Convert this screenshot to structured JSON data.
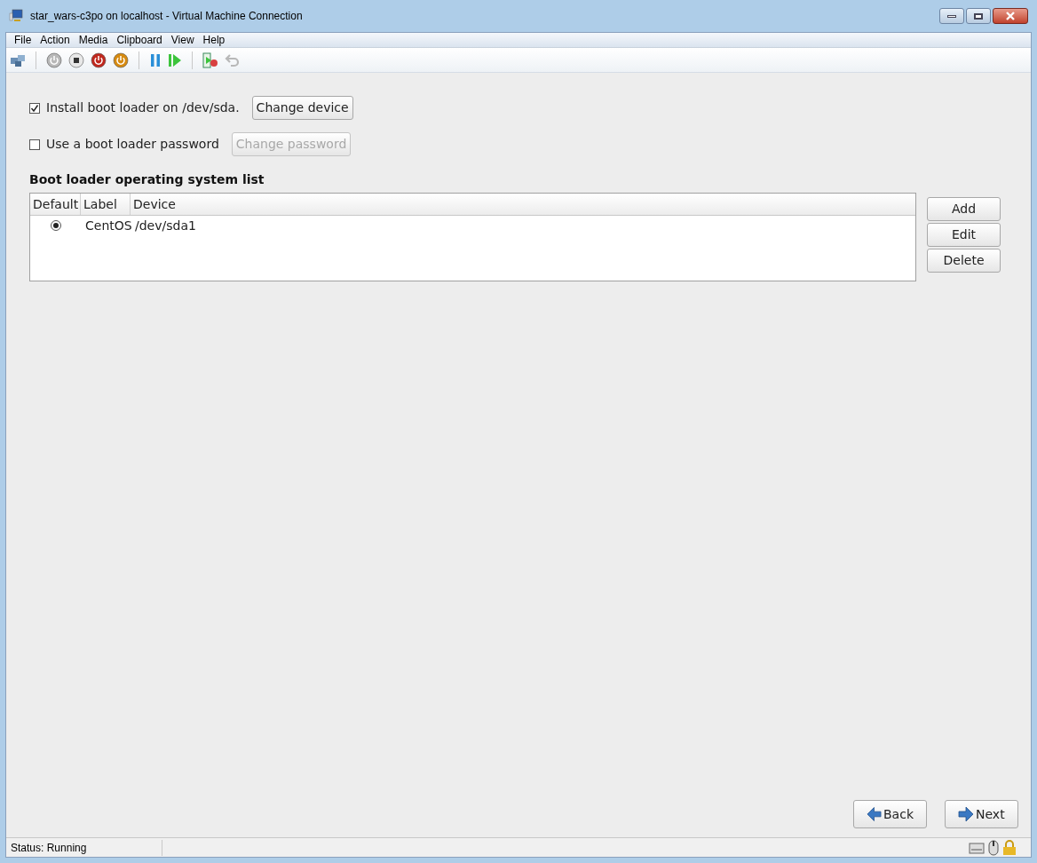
{
  "window": {
    "title": "star_wars-c3po on localhost - Virtual Machine Connection"
  },
  "menu": [
    "File",
    "Action",
    "Media",
    "Clipboard",
    "View",
    "Help"
  ],
  "toolbar": [
    {
      "kind": "connect",
      "disabled": false
    },
    {
      "kind": "sep"
    },
    {
      "kind": "start",
      "disabled": true
    },
    {
      "kind": "turnoff",
      "disabled": false
    },
    {
      "kind": "shutdown",
      "disabled": false
    },
    {
      "kind": "save",
      "disabled": false
    },
    {
      "kind": "sep"
    },
    {
      "kind": "pause",
      "disabled": false
    },
    {
      "kind": "reset",
      "disabled": false
    },
    {
      "kind": "sep"
    },
    {
      "kind": "snapshot",
      "disabled": false
    },
    {
      "kind": "revert",
      "disabled": true
    }
  ],
  "options": [
    {
      "label": "Install boot loader on /dev/sda.",
      "checked": true,
      "button": {
        "label": "Change device",
        "disabled": false
      }
    },
    {
      "label": "Use a boot loader password",
      "checked": false,
      "button": {
        "label": "Change password",
        "disabled": true
      }
    }
  ],
  "os_list": {
    "title": "Boot loader operating system list",
    "columns": [
      "Default",
      "Label",
      "Device"
    ],
    "rows": [
      {
        "selected": true,
        "label": "CentOS",
        "device": "/dev/sda1"
      }
    ],
    "buttons": [
      "Add",
      "Edit",
      "Delete"
    ]
  },
  "nav": [
    {
      "kind": "back",
      "label": "Back"
    },
    {
      "kind": "next",
      "label": "Next"
    }
  ],
  "status_bar": {
    "text": "Status: Running"
  }
}
